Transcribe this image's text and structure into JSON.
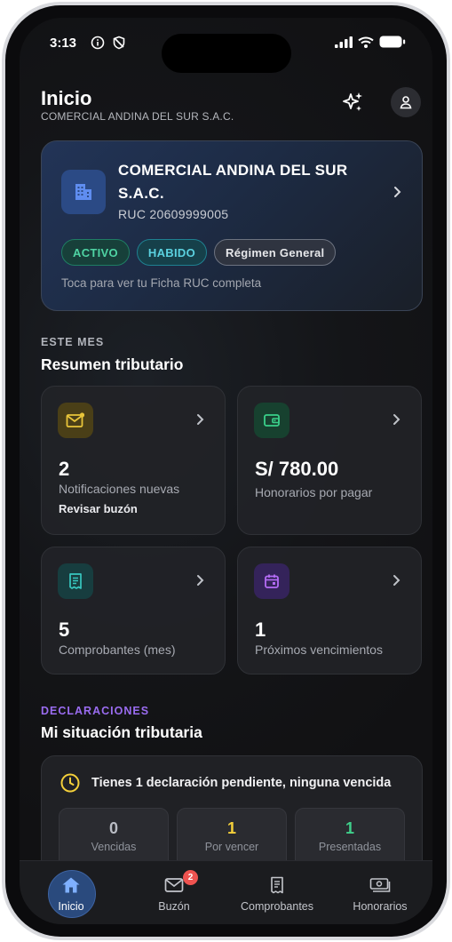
{
  "status_bar": {
    "time": "3:13"
  },
  "header": {
    "title": "Inicio",
    "subtitle": "COMERCIAL ANDINA DEL SUR S.A.C.",
    "actions": [
      "sparkles-icon",
      "user-icon"
    ]
  },
  "company_card": {
    "name": "COMERCIAL ANDINA DEL SUR S.A.C.",
    "ruc": "RUC 20609999005",
    "badges": [
      "ACTIVO",
      "HABIDO",
      "Régimen General"
    ],
    "hint": "Toca para ver tu Ficha RUC completa",
    "icon": "building-icon"
  },
  "summary": {
    "eyebrow": "ESTE MES",
    "title": "Resumen tributario",
    "cards": [
      {
        "value": "2",
        "label": "Notificaciones nuevas",
        "link": "Revisar buzón",
        "icon": "mail-icon",
        "color": "#e8c53a"
      },
      {
        "value": "S/ 780.00",
        "label": "Honorarios por pagar",
        "icon": "wallet-icon",
        "color": "#3ad08a"
      },
      {
        "value": "5",
        "label": "Comprobantes (mes)",
        "icon": "receipt-icon",
        "color": "#38c7c0"
      },
      {
        "value": "1",
        "label": "Próximos vencimientos",
        "icon": "calendar-icon",
        "color": "#b46cf5"
      }
    ]
  },
  "declarations": {
    "eyebrow": "DECLARACIONES",
    "title": "Mi situación tributaria",
    "message": "Tienes 1 declaración pendiente, ninguna vencida",
    "stats": [
      {
        "value": "0",
        "label": "Vencidas",
        "color": "#b9bcc4"
      },
      {
        "value": "1",
        "label": "Por vencer",
        "color": "#f3cf3a"
      },
      {
        "value": "1",
        "label": "Presentadas",
        "color": "#3fcf8a"
      }
    ]
  },
  "tabbar": {
    "tabs": [
      {
        "label": "Inicio",
        "icon": "home-icon",
        "active": true
      },
      {
        "label": "Buzón",
        "icon": "mail-icon",
        "badge": "2"
      },
      {
        "label": "Comprobantes",
        "icon": "receipt-icon"
      },
      {
        "label": "Honorarios",
        "icon": "cash-icon"
      }
    ]
  },
  "colors": {
    "accent": "#2a4a7d",
    "eyebrow_purple": "#9a6cf0",
    "badge_red": "#ef5350"
  }
}
